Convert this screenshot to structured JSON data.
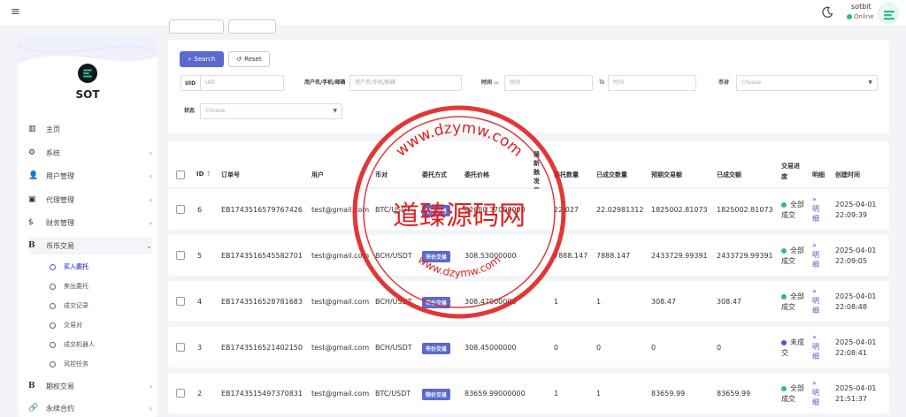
{
  "header": {
    "username": "sotbit",
    "status": "Online"
  },
  "sidebar": {
    "brand": "SOT",
    "items": [
      {
        "label": "主页",
        "icon": "bar-chart-icon"
      },
      {
        "label": "系统",
        "icon": "gear-icon"
      },
      {
        "label": "用户管理",
        "icon": "user-icon"
      },
      {
        "label": "代理管理",
        "icon": "id-card-icon"
      },
      {
        "label": "财务管理",
        "icon": "dollar-icon"
      },
      {
        "label": "币币交易",
        "icon": "bitcoin-icon"
      }
    ],
    "sub_items": [
      {
        "label": "买入委托"
      },
      {
        "label": "卖出委托"
      },
      {
        "label": "成交记录"
      },
      {
        "label": "交易对"
      },
      {
        "label": "成交机器人"
      },
      {
        "label": "风控任务"
      }
    ],
    "more_items": [
      {
        "label": "期权交易",
        "icon": "bitcoin-icon"
      },
      {
        "label": "永续合约",
        "icon": "link-icon"
      }
    ]
  },
  "filters": {
    "search_label": "Search",
    "reset_label": "Reset",
    "uid_label": "UID",
    "uid_placeholder": "UID",
    "user_label": "用户名/手机/邮箱",
    "user_placeholder": "用户名/手机/邮箱",
    "time_label": "时间",
    "time_placeholder": "时间",
    "to_label": "To",
    "to_placeholder": "时间",
    "pair_label": "币对",
    "pair_placeholder": "Choose",
    "status_label": "状态",
    "status_placeholder": "Choose"
  },
  "table": {
    "headers": [
      "ID",
      "订单号",
      "用户",
      "币对",
      "委托方式",
      "委托价格",
      "最新触发价",
      "委托数量",
      "已成交数量",
      "预期交易额",
      "已成交额",
      "交易进度",
      "明细",
      "创建时间"
    ],
    "rows": [
      {
        "id": "6",
        "order": "EB1743516579767426",
        "user": "test@gmail.com",
        "pair": "BTC/USDT",
        "type": "限价交易",
        "price": "82680.37000000",
        "trigger": "",
        "qty": "22.027",
        "filled": "22.02981312",
        "expected": "1825002.81073",
        "done": "1825002.81073",
        "progress": "全部成交",
        "detail": "明细",
        "created": "2025-04-01 22:09:39",
        "color": "#2fbf71"
      },
      {
        "id": "5",
        "order": "EB1743516545582701",
        "user": "test@gmail.com",
        "pair": "BCH/USDT",
        "type": "市价交易",
        "price": "308.53000000",
        "trigger": "",
        "qty": "7888.147",
        "filled": "7888.147",
        "expected": "2433729.99391",
        "done": "2433729.99391",
        "progress": "全部成交",
        "detail": "明细",
        "created": "2025-04-01 22:09:05",
        "color": "#2fbf71"
      },
      {
        "id": "4",
        "order": "EB1743516528781683",
        "user": "test@gmail.com",
        "pair": "BCH/USDT",
        "type": "市价交易",
        "price": "308.47000000",
        "trigger": "",
        "qty": "1",
        "filled": "1",
        "expected": "308.47",
        "done": "308.47",
        "progress": "全部成交",
        "detail": "明细",
        "created": "2025-04-01 22:08:48",
        "color": "#2fbf71"
      },
      {
        "id": "3",
        "order": "EB1743516521402150",
        "user": "test@gmail.com",
        "pair": "BCH/USDT",
        "type": "市价交易",
        "price": "308.45000000",
        "trigger": "",
        "qty": "0",
        "filled": "0",
        "expected": "0",
        "done": "0",
        "progress": "未成交",
        "detail": "明细",
        "created": "2025-04-01 22:08:41",
        "color": "#4a5cc2"
      },
      {
        "id": "2",
        "order": "EB1743515497370831",
        "user": "test@gmail.com",
        "pair": "BTC/USDT",
        "type": "限价交易",
        "price": "83659.99000000",
        "trigger": "",
        "qty": "1",
        "filled": "1",
        "expected": "83659.99",
        "done": "83659.99",
        "progress": "全部成交",
        "detail": "明细",
        "created": "2025-04-01 21:51:37",
        "color": "#2fbf71"
      }
    ]
  },
  "watermark": {
    "text": "道臻源码网",
    "ring": "www.dzymw.com"
  },
  "colors": {
    "accent": "#5a6acf",
    "stamp": "#e02020",
    "success": "#2fbf71"
  }
}
